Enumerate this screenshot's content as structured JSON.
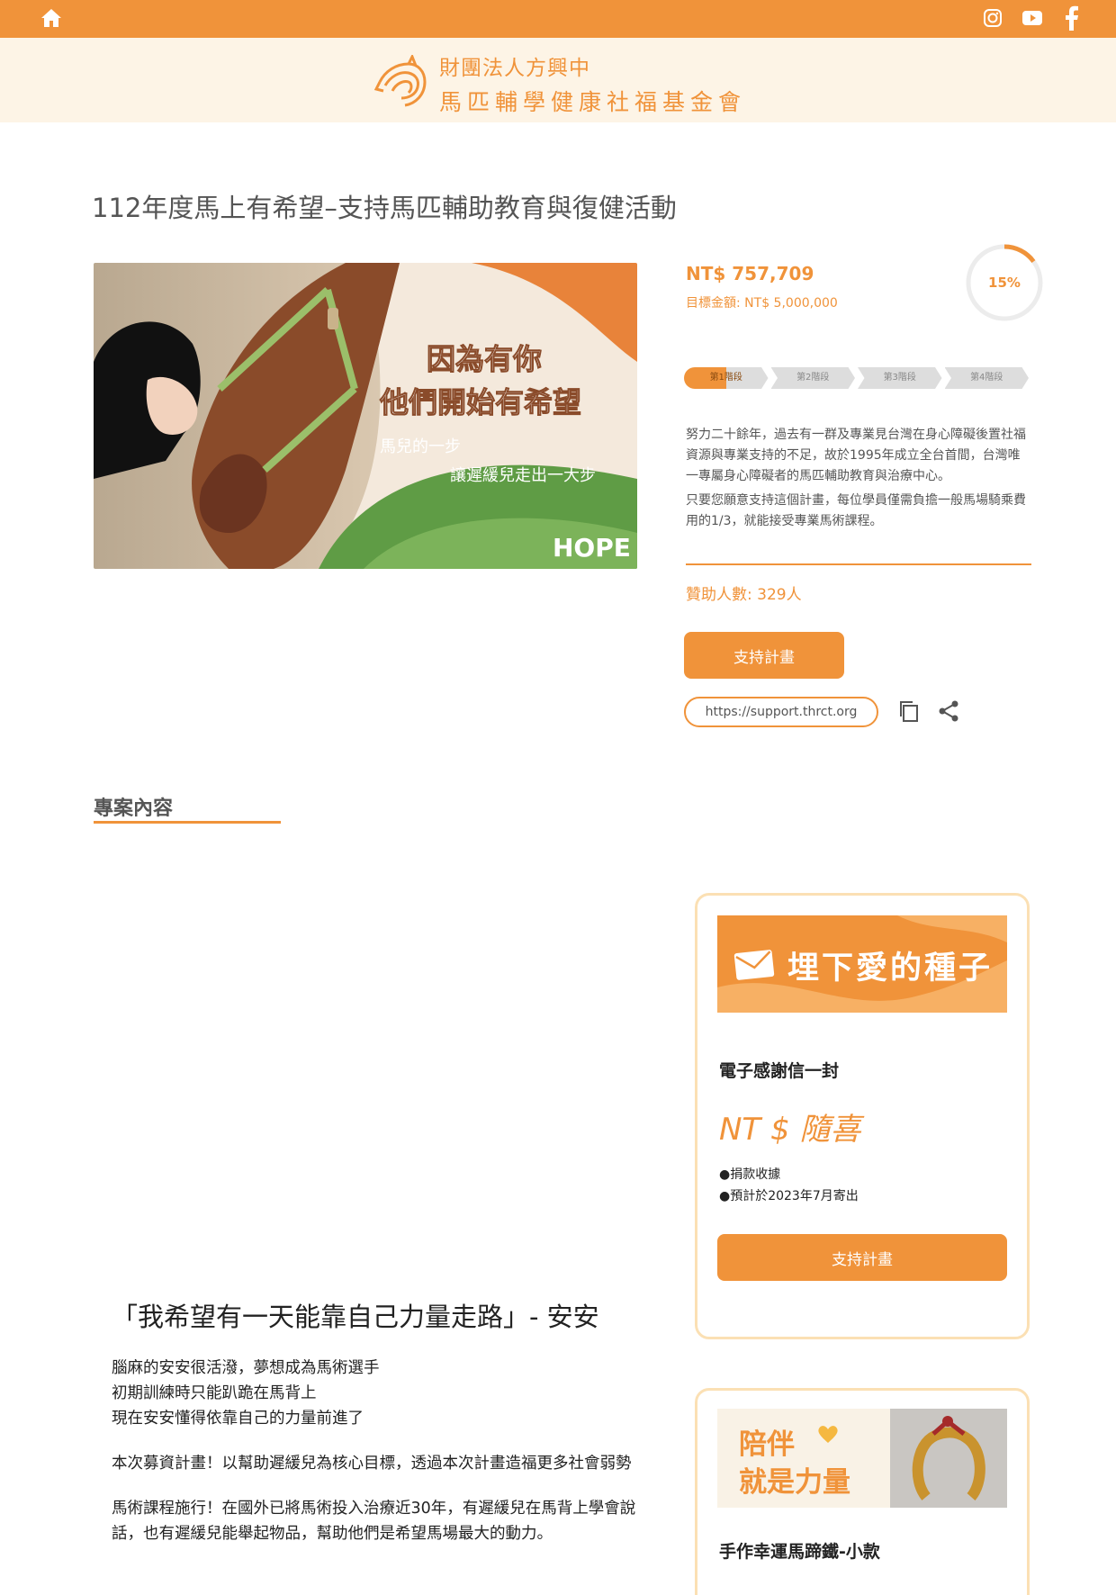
{
  "brand": {
    "name_line1": "財團法人方興中",
    "name_line2": "馬匹輔學健康社福基金會"
  },
  "project": {
    "title": "112年度馬上有希望–支持馬匹輔助教育與復健活動",
    "hero": {
      "headline1": "因為有你",
      "headline2": "他們開始有希望",
      "sub1": "馬兒的一步",
      "sub2": "讓遲緩兒走出一大步",
      "logo": "HOPE"
    },
    "amount": "NT$ 757,709",
    "goal": "目標金額: NT$ 5,000,000",
    "progress_percent": 15,
    "progress_label": "15%",
    "stages": [
      "第1階段",
      "第2階段",
      "第3階段",
      "第4階段"
    ],
    "description": [
      "努力二十餘年，過去有一群及專業見台灣在身心障礙後置社福資源與專業支持的不足，故於1995年成立全台首間，台灣唯一專屬身心障礙者的馬匹輔助教育與治療中心。",
      "只要您願意支持這個計畫，每位學員僅需負擔一般馬場騎乘費用的1/3，就能接受專業馬術課程。"
    ],
    "backers": "贊助人數: 329人",
    "support_label": "支持計畫",
    "link": "https://support.thrct.org"
  },
  "content": {
    "section_title": "專案內容",
    "quote": "「我希望有一天能靠自己力量走路」- 安安",
    "story": [
      [
        "腦麻的安安很活潑，夢想成為馬術選手",
        "初期訓練時只能趴跪在馬背上",
        "現在安安懂得依靠自己的力量前進了"
      ],
      [
        "本次募資計畫！以幫助遲緩兒為核心目標，透過本次計畫造福更多社會弱勢"
      ],
      [
        "馬術課程施行！在國外已將馬術投入治療近30年，有遲緩兒在馬背上學會說話，也有遲緩兒能舉起物品，幫助他們是希望馬場最大的動力。"
      ]
    ]
  },
  "rewards": [
    {
      "banner": "埋下愛的種子",
      "title": "電子感謝信一封",
      "price": "NT $ 隨喜",
      "notes": [
        "●捐款收據",
        "●預計於2023年7月寄出"
      ],
      "button": "支持計畫"
    },
    {
      "banner_line1": "陪伴",
      "banner_line2": "就是力量",
      "title": "手作幸運馬蹄鐵-小款"
    }
  ],
  "colors": {
    "accent": "#f0933a",
    "brand_bg": "#fdf4e6",
    "card_border": "#fbe0b4"
  },
  "icons": [
    "home-icon",
    "instagram-icon",
    "youtube-icon",
    "facebook-icon",
    "copy-icon",
    "share-icon",
    "mail-icon",
    "heart-icon"
  ]
}
